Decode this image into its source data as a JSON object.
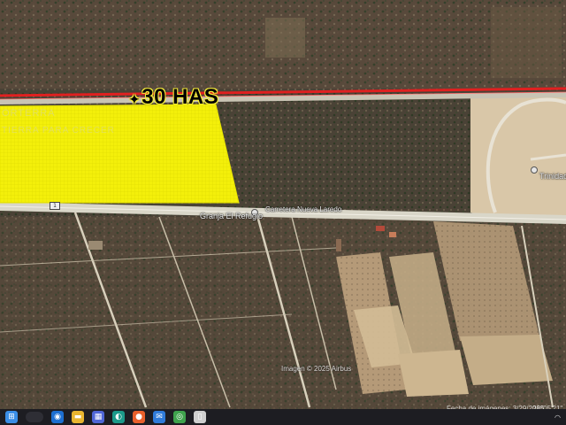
{
  "map": {
    "parcel_label": "30 HAS",
    "watermark_lines": [
      "ORTERRA",
      "TIERRA PARA CRECER"
    ],
    "road_name": "Carretera Nueva Laredo",
    "road_shield": "1",
    "poi_label": "Granja El Refugio",
    "poi_label_right": "Trinidad",
    "copyright": "Imagen © 2025 Airbus",
    "imagery_date": "Fecha de imágenes: 3/29/2025",
    "coords": "26°05'21\"",
    "colors": {
      "parcel_fill": "#f4f00a",
      "boundary_line": "#e02020",
      "road": "#d9d6c8"
    }
  },
  "taskbar": {
    "apps": [
      {
        "name": "windows-start-icon",
        "glyph": "⊞",
        "color": "#3a8ee6"
      },
      {
        "name": "search-icon",
        "glyph": "",
        "color": "#2e2e35"
      },
      {
        "name": "widgets-icon",
        "glyph": "◉",
        "color": "#1d6fd1"
      },
      {
        "name": "file-explorer-icon",
        "glyph": "▬",
        "color": "#e8b530"
      },
      {
        "name": "store-icon",
        "glyph": "▦",
        "color": "#4f66d6"
      },
      {
        "name": "edge-icon",
        "glyph": "◐",
        "color": "#1c9a8a"
      },
      {
        "name": "firefox-icon",
        "glyph": "●",
        "color": "#e8602c"
      },
      {
        "name": "mail-icon",
        "glyph": "✉",
        "color": "#2f7bd9"
      },
      {
        "name": "chrome-icon",
        "glyph": "◎",
        "color": "#3fa34d"
      },
      {
        "name": "document-icon",
        "glyph": "▯",
        "color": "#cfcfcf"
      }
    ]
  }
}
